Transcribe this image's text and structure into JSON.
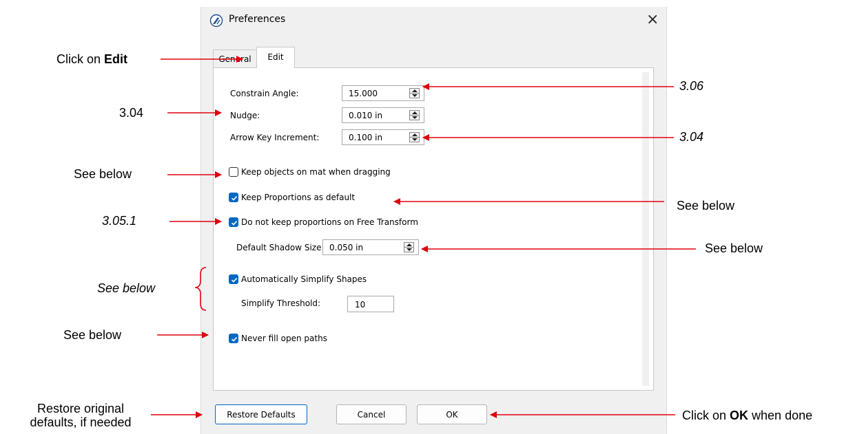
{
  "window": {
    "title": "Preferences",
    "close_symbol": "×",
    "app_icon": "app-logo-icon"
  },
  "tabs": [
    {
      "label": "General",
      "selected": false
    },
    {
      "label": "Edit",
      "selected": true
    }
  ],
  "fields": {
    "constrain_angle": {
      "label": "Constrain Angle:",
      "value": "15.000"
    },
    "nudge": {
      "label": "Nudge:",
      "value": "0.010 in"
    },
    "arrow_key_increment": {
      "label": "Arrow Key Increment:",
      "value": "0.100 in"
    },
    "default_shadow_size": {
      "label": "Default Shadow Size:",
      "value": "0.050 in"
    },
    "simplify_threshold": {
      "label": "Simplify Threshold:",
      "value": "10"
    }
  },
  "checkboxes": {
    "keep_on_mat": {
      "label": "Keep objects on mat when dragging",
      "checked": false
    },
    "keep_proportions": {
      "label": "Keep Proportions as default",
      "checked": true
    },
    "no_keep_free_transform": {
      "label": "Do not keep proportions on Free Transform",
      "checked": true
    },
    "auto_simplify": {
      "label": "Automatically Simplify Shapes",
      "checked": true
    },
    "never_fill_open": {
      "label": "Never fill open paths",
      "checked": true
    }
  },
  "buttons": {
    "restore": "Restore Defaults",
    "cancel": "Cancel",
    "ok": "OK"
  },
  "annotations": {
    "click_on_edit_prefix": "Click on ",
    "click_on_edit_bold": "Edit",
    "nudge_left": "3.04",
    "keep_on_mat_left": "See below",
    "free_transform_left": "3.05.1",
    "simplify_left": "See below",
    "never_fill_left": "See below",
    "restore_line1": "Restore original",
    "restore_line2": "defaults, if needed",
    "constrain_right": "3.06",
    "arrow_key_right": "3.04",
    "keep_proportions_right": "See below",
    "shadow_right": "See below",
    "ok_prefix": "Click on ",
    "ok_bold": "OK",
    "ok_suffix": " when done"
  },
  "colors": {
    "arrow": "#e0000e",
    "checkbox_accent": "#0067c0"
  }
}
